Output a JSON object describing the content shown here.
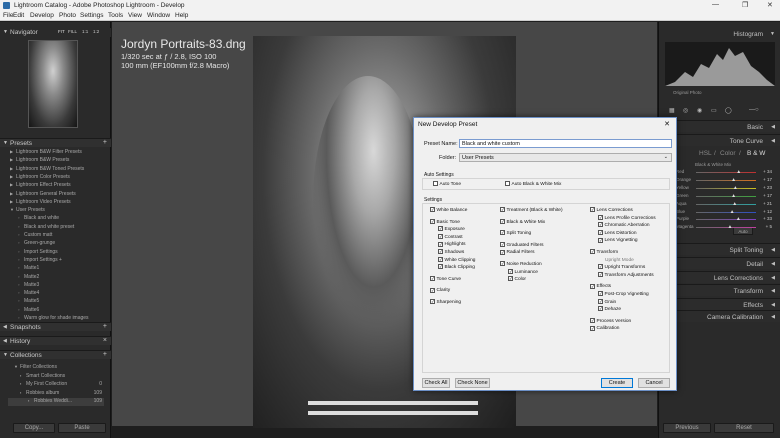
{
  "window": {
    "title": "Lightroom Catalog - Adobe Photoshop Lightroom - Develop",
    "minimize": "—",
    "restore": "❐",
    "close": "✕"
  },
  "menu": [
    "File",
    "Edit",
    "Develop",
    "Photo",
    "Settings",
    "Tools",
    "View",
    "Window",
    "Help"
  ],
  "navigator": {
    "title": "Navigator",
    "zoom": [
      "FIT",
      "FILL",
      "1:1",
      "1:2"
    ]
  },
  "presets_panel": {
    "title": "Presets",
    "add": "+",
    "items": [
      {
        "label": "Lightroom B&W Filter Presets",
        "indent": 0
      },
      {
        "label": "Lightroom B&W Presets",
        "indent": 0
      },
      {
        "label": "Lightroom B&W Toned Presets",
        "indent": 0
      },
      {
        "label": "Lightroom Color Presets",
        "indent": 0
      },
      {
        "label": "Lightroom Effect Presets",
        "indent": 0
      },
      {
        "label": "Lightroom General Presets",
        "indent": 0
      },
      {
        "label": "Lightroom Video Presets",
        "indent": 0
      },
      {
        "label": "User Presets",
        "indent": 0,
        "open": true
      },
      {
        "label": "Black and white",
        "indent": 1
      },
      {
        "label": "Black and white preset",
        "indent": 1
      },
      {
        "label": "Custom matt",
        "indent": 1
      },
      {
        "label": "Green-grunge",
        "indent": 1
      },
      {
        "label": "Import Settings",
        "indent": 1
      },
      {
        "label": "Import Settings +",
        "indent": 1
      },
      {
        "label": "Matte1",
        "indent": 1
      },
      {
        "label": "Matte2",
        "indent": 1
      },
      {
        "label": "Matte3",
        "indent": 1
      },
      {
        "label": "Matte4",
        "indent": 1
      },
      {
        "label": "Matte5",
        "indent": 1
      },
      {
        "label": "Matte6",
        "indent": 1
      },
      {
        "label": "Warm glow for shade images",
        "indent": 1
      }
    ]
  },
  "snapshots": {
    "title": "Snapshots",
    "add": "+"
  },
  "history": {
    "title": "History",
    "clear": "×"
  },
  "collections": {
    "title": "Collections",
    "add": "+",
    "items": [
      {
        "label": "Filter Collections",
        "count": ""
      },
      {
        "label": "Smart Collections",
        "count": ""
      },
      {
        "label": "My First Collection",
        "count": "0"
      },
      {
        "label": "Robbies album",
        "count": "109"
      },
      {
        "label": "Robbies Weddi...",
        "count": "109"
      }
    ]
  },
  "left_buttons": {
    "copy": "Copy...",
    "paste": "Paste"
  },
  "photo_info": {
    "filename": "Jordyn Portraits-83.dng",
    "exposure": "1/320 sec at ƒ / 2.8, ISO 100",
    "lens": "100 mm (EF100mm f/2.8 Macro)"
  },
  "right_panel": {
    "histogram": "Histogram",
    "original_photo": "Original Photo",
    "basic": "Basic",
    "tone_curve": "Tone Curve",
    "tabs": [
      "HSL",
      "/",
      "Color",
      "/",
      "B & W"
    ],
    "bw_mix": "Black & White Mix",
    "sliders": [
      {
        "name": "Red",
        "value": "+ 34"
      },
      {
        "name": "Orange",
        "value": "+ 17"
      },
      {
        "name": "Yellow",
        "value": "+ 23"
      },
      {
        "name": "Green",
        "value": "+ 17"
      },
      {
        "name": "Aqua",
        "value": "+ 21"
      },
      {
        "name": "Blue",
        "value": "+ 12"
      },
      {
        "name": "Purple",
        "value": "+ 33"
      },
      {
        "name": "Magenta",
        "value": "+ 5"
      }
    ],
    "auto": "Auto",
    "sections": [
      "Split Toning",
      "Detail",
      "Lens Corrections",
      "Transform",
      "Effects",
      "Camera Calibration"
    ],
    "previous": "Previous",
    "reset": "Reset"
  },
  "dialog": {
    "title": "New Develop Preset",
    "close": "✕",
    "preset_name_label": "Preset Name:",
    "preset_name_value": "Black and white custom",
    "folder_label": "Folder:",
    "folder_value": "User Presets",
    "auto_settings": "Auto Settings",
    "auto_tone": "Auto Tone",
    "auto_bw": "Auto Black & White Mix",
    "settings": "Settings",
    "col1": [
      {
        "label": "White Balance",
        "checked": true,
        "indent": 0
      },
      {
        "label": "Basic Tone",
        "checked": true,
        "indent": 0,
        "gap": true
      },
      {
        "label": "Exposure",
        "checked": true,
        "indent": 1
      },
      {
        "label": "Contrast",
        "checked": true,
        "indent": 1
      },
      {
        "label": "Highlights",
        "checked": true,
        "indent": 1
      },
      {
        "label": "Shadows",
        "checked": true,
        "indent": 1
      },
      {
        "label": "White Clipping",
        "checked": true,
        "indent": 1
      },
      {
        "label": "Black Clipping",
        "checked": true,
        "indent": 1
      },
      {
        "label": "Tone Curve",
        "checked": true,
        "indent": 0,
        "gap": true
      },
      {
        "label": "Clarity",
        "checked": true,
        "indent": 0,
        "gap": true
      },
      {
        "label": "Sharpening",
        "checked": true,
        "indent": 0,
        "gap": true
      }
    ],
    "col2": [
      {
        "label": "Treatment (Black & White)",
        "checked": true,
        "indent": 0
      },
      {
        "label": "Black & White Mix",
        "checked": true,
        "indent": 0,
        "gap": true
      },
      {
        "label": "Split Toning",
        "checked": true,
        "indent": 0,
        "gap": true
      },
      {
        "label": "Graduated Filters",
        "checked": true,
        "indent": 0,
        "gap": true
      },
      {
        "label": "Radial Filters",
        "checked": true,
        "indent": 0
      },
      {
        "label": "Noise Reduction",
        "checked": true,
        "indent": 0,
        "gap": true
      },
      {
        "label": "Luminance",
        "checked": true,
        "indent": 1
      },
      {
        "label": "Color",
        "checked": true,
        "indent": 1
      }
    ],
    "col3": [
      {
        "label": "Lens Corrections",
        "checked": true,
        "indent": 0
      },
      {
        "label": "Lens Profile Corrections",
        "checked": true,
        "indent": 1
      },
      {
        "label": "Chromatic Aberration",
        "checked": true,
        "indent": 1
      },
      {
        "label": "Lens Distortion",
        "checked": true,
        "indent": 1
      },
      {
        "label": "Lens Vignetting",
        "checked": true,
        "indent": 1
      },
      {
        "label": "Transform",
        "checked": true,
        "indent": 0,
        "gap": true
      },
      {
        "label": "Upright Mode",
        "checked": null,
        "indent": 1
      },
      {
        "label": "Upright Transforms",
        "checked": true,
        "indent": 1
      },
      {
        "label": "Transform Adjustments",
        "checked": true,
        "indent": 1
      },
      {
        "label": "Effects",
        "checked": true,
        "indent": 0,
        "gap": true
      },
      {
        "label": "Post-Crop Vignetting",
        "checked": true,
        "indent": 1
      },
      {
        "label": "Grain",
        "checked": true,
        "indent": 1
      },
      {
        "label": "Dehaze",
        "checked": true,
        "indent": 1
      },
      {
        "label": "Process Version",
        "checked": true,
        "indent": 0,
        "gap": true
      },
      {
        "label": "Calibration",
        "checked": true,
        "indent": 0
      }
    ],
    "check_all": "Check All",
    "check_none": "Check None",
    "create": "Create",
    "cancel": "Cancel"
  }
}
